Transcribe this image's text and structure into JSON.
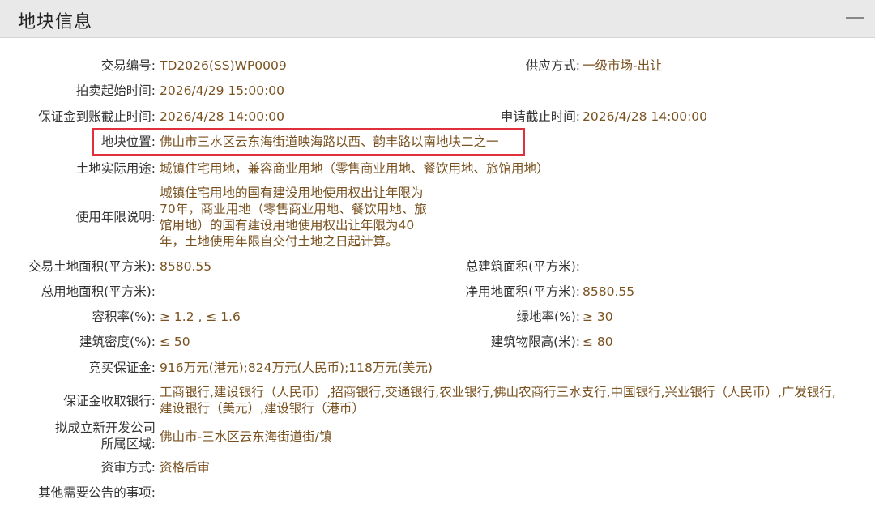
{
  "header": {
    "title": "地块信息",
    "collapse_icon": "minus-icon"
  },
  "rows": {
    "trade_no": {
      "label": "交易编号:",
      "value": "TD2026(SS)WP0009"
    },
    "supply_method": {
      "label": "供应方式:",
      "value": "一级市场-出让"
    },
    "auction_start": {
      "label": "拍卖起始时间:",
      "value": "2026/4/29 15:00:00"
    },
    "deposit_deadline": {
      "label": "保证金到账截止时间:",
      "value": "2026/4/28 14:00:00"
    },
    "apply_deadline": {
      "label": "申请截止时间:",
      "value": "2026/4/28 14:00:00"
    },
    "location": {
      "label": "地块位置:",
      "value": "佛山市三水区云东海街道映海路以西、韵丰路以南地块二之一"
    },
    "actual_use": {
      "label": "土地实际用途:",
      "value": "城镇住宅用地，兼容商业用地（零售商业用地、餐饮用地、旅馆用地）"
    },
    "term_desc": {
      "label": "使用年限说明:",
      "lines": [
        "城镇住宅用地的国有建设用地使用权出让年限为",
        "70年，商业用地（零售商业用地、餐饮用地、旅",
        "馆用地）的国有建设用地使用权出让年限为40",
        "年，土地使用年限自交付土地之日起计算。"
      ]
    },
    "trade_area": {
      "label": "交易土地面积(平方米):",
      "value": "8580.55"
    },
    "total_build_area": {
      "label": "总建筑面积(平方米):",
      "value": ""
    },
    "total_land_area": {
      "label": "总用地面积(平方米):",
      "value": ""
    },
    "net_land_area": {
      "label": "净用地面积(平方米):",
      "value": "8580.55"
    },
    "plot_ratio": {
      "label": "容积率(%):",
      "value": "≥ 1.2 , ≤ 1.6"
    },
    "green_ratio": {
      "label": "绿地率(%):",
      "value": "≥ 30"
    },
    "build_density": {
      "label": "建筑密度(%):",
      "value": "≤ 50"
    },
    "height_limit": {
      "label": "建筑物限高(米):",
      "value": "≤ 80"
    },
    "bid_deposit": {
      "label": "竞买保证金:",
      "value": "916万元(港元);824万元(人民币);118万元(美元)"
    },
    "deposit_banks": {
      "label": "保证金收取银行:",
      "lines": [
        "工商银行,建设银行（人民币）,招商银行,交通银行,农业银行,佛山农商行三水支行,中国银行,兴业银行（人民币）,广发银行,",
        "建设银行（美元）,建设银行（港币）"
      ]
    },
    "new_company_area": {
      "label_lines": [
        "拟成立新开发公司",
        "所属区域:"
      ],
      "value": "佛山市-三水区云东海街道街/镇"
    },
    "review_method": {
      "label": "资审方式:",
      "value": "资格后审"
    },
    "other_notes": {
      "label": "其他需要公告的事项:",
      "value": ""
    }
  }
}
